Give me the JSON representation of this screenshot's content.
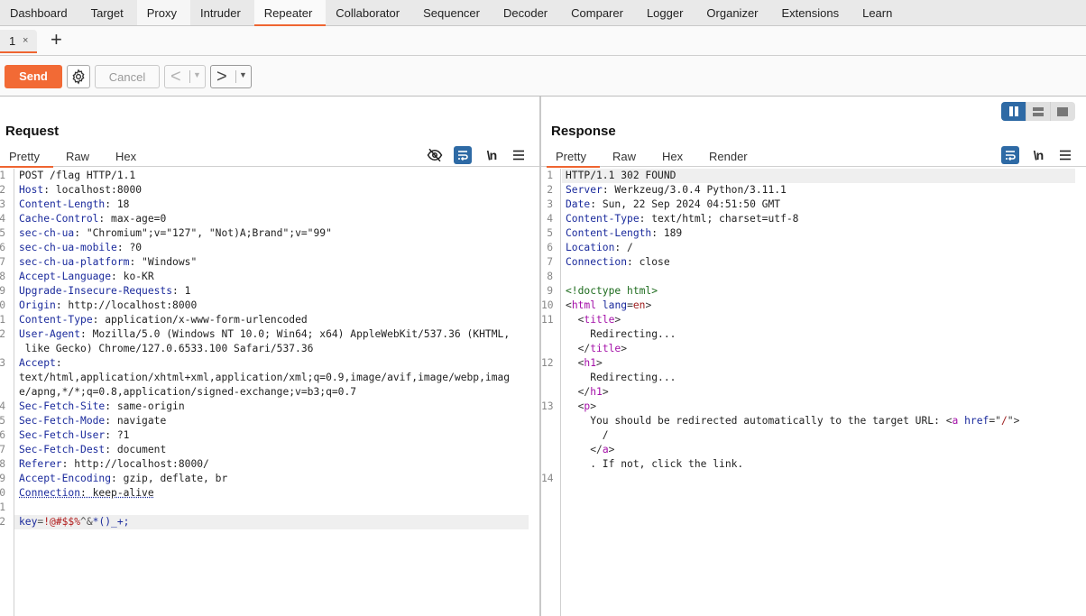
{
  "topnav": {
    "tabs": [
      {
        "label": "Dashboard"
      },
      {
        "label": "Target"
      },
      {
        "label": "Proxy"
      },
      {
        "label": "Intruder"
      },
      {
        "label": "Repeater",
        "active": true
      },
      {
        "label": "Collaborator"
      },
      {
        "label": "Sequencer"
      },
      {
        "label": "Decoder"
      },
      {
        "label": "Comparer"
      },
      {
        "label": "Logger"
      },
      {
        "label": "Organizer"
      },
      {
        "label": "Extensions"
      },
      {
        "label": "Learn"
      }
    ]
  },
  "repeater_tabs": {
    "tabs": [
      {
        "label": "1",
        "close": "×"
      }
    ],
    "add_label": "+"
  },
  "toolbar": {
    "send_label": "Send",
    "cancel_label": "Cancel",
    "back_arrow": "<",
    "forward_arrow": ">",
    "dropdown_glyph": "▼",
    "accent_color": "#f26a35"
  },
  "request": {
    "title": "Request",
    "view_tabs": [
      "Pretty",
      "Raw",
      "Hex"
    ],
    "active_view": "Pretty",
    "newline_label": "\\n",
    "lines": [
      {
        "num": "1",
        "text": "POST /flag HTTP/1.1"
      },
      {
        "num": "2",
        "name": "Host",
        "value": " localhost:8000"
      },
      {
        "num": "3",
        "name": "Content-Length",
        "value": " 18"
      },
      {
        "num": "4",
        "name": "Cache-Control",
        "value": " max-age=0"
      },
      {
        "num": "5",
        "name": "sec-ch-ua",
        "value": " \"Chromium\";v=\"127\", \"Not)A;Brand\";v=\"99\""
      },
      {
        "num": "6",
        "name": "sec-ch-ua-mobile",
        "value": " ?0"
      },
      {
        "num": "7",
        "name": "sec-ch-ua-platform",
        "value": " \"Windows\""
      },
      {
        "num": "8",
        "name": "Accept-Language",
        "value": " ko-KR"
      },
      {
        "num": "9",
        "name": "Upgrade-Insecure-Requests",
        "value": " 1"
      },
      {
        "num": "0",
        "name": "Origin",
        "value": " http://localhost:8000"
      },
      {
        "num": "1",
        "name": "Content-Type",
        "value": " application/x-www-form-urlencoded"
      },
      {
        "num": "2",
        "name": "User-Agent",
        "value": " Mozilla/5.0 (Windows NT 10.0; Win64; x64) AppleWebKit/537.36 (KHTML,"
      },
      {
        "num": "",
        "text": " like Gecko) Chrome/127.0.6533.100 Safari/537.36"
      },
      {
        "num": "3",
        "name": "Accept",
        "value": ""
      },
      {
        "num": "",
        "text": "text/html,application/xhtml+xml,application/xml;q=0.9,image/avif,image/webp,imag"
      },
      {
        "num": "",
        "text": "e/apng,*/*;q=0.8,application/signed-exchange;v=b3;q=0.7"
      },
      {
        "num": "4",
        "name": "Sec-Fetch-Site",
        "value": " same-origin"
      },
      {
        "num": "5",
        "name": "Sec-Fetch-Mode",
        "value": " navigate"
      },
      {
        "num": "6",
        "name": "Sec-Fetch-User",
        "value": " ?1"
      },
      {
        "num": "7",
        "name": "Sec-Fetch-Dest",
        "value": " document"
      },
      {
        "num": "8",
        "name": "Referer",
        "value": " http://localhost:8000/"
      },
      {
        "num": "9",
        "name": "Accept-Encoding",
        "value": " gzip, deflate, br"
      },
      {
        "num": "0",
        "name": "Connection",
        "value": " keep-alive",
        "underline": true
      },
      {
        "num": "1",
        "text": ""
      },
      {
        "num": "2",
        "body": true,
        "highlight": true,
        "key": "key",
        "eq": "=",
        "red": "!@#$$%",
        "gray": "^&",
        "blue": "*()_+;"
      }
    ]
  },
  "response": {
    "title": "Response",
    "view_tabs": [
      "Pretty",
      "Raw",
      "Hex",
      "Render"
    ],
    "active_view": "Pretty",
    "newline_label": "\\n",
    "lines": [
      {
        "num": "1",
        "text": "HTTP/1.1 302 FOUND",
        "highlight": true
      },
      {
        "num": "2",
        "name": "Server",
        "value": " Werkzeug/3.0.4 Python/3.11.1"
      },
      {
        "num": "3",
        "name": "Date",
        "value": " Sun, 22 Sep 2024 04:51:50 GMT"
      },
      {
        "num": "4",
        "name": "Content-Type",
        "value": " text/html; charset=utf-8"
      },
      {
        "num": "5",
        "name": "Content-Length",
        "value": " 189"
      },
      {
        "num": "6",
        "name": "Location",
        "value": " /"
      },
      {
        "num": "7",
        "name": "Connection",
        "value": " close"
      },
      {
        "num": "8",
        "text": ""
      },
      {
        "num": "9",
        "html": [
          {
            "cls": "doctype",
            "t": "<!doctype html>"
          }
        ]
      },
      {
        "num": "10",
        "html": [
          {
            "cls": "punct",
            "t": "<"
          },
          {
            "cls": "tag",
            "t": "html"
          },
          {
            "cls": "punct",
            "t": " "
          },
          {
            "cls": "attr",
            "t": "lang"
          },
          {
            "cls": "punct",
            "t": "="
          },
          {
            "cls": "aval",
            "t": "en"
          },
          {
            "cls": "punct",
            "t": ">"
          }
        ]
      },
      {
        "num": "11",
        "html": [
          {
            "cls": "punct",
            "t": "  <"
          },
          {
            "cls": "tag",
            "t": "title"
          },
          {
            "cls": "punct",
            "t": ">"
          }
        ]
      },
      {
        "num": "",
        "html": [
          {
            "cls": "hval",
            "t": "    Redirecting..."
          }
        ]
      },
      {
        "num": "",
        "html": [
          {
            "cls": "punct",
            "t": "  </"
          },
          {
            "cls": "tag",
            "t": "title"
          },
          {
            "cls": "punct",
            "t": ">"
          }
        ]
      },
      {
        "num": "12",
        "html": [
          {
            "cls": "punct",
            "t": "  <"
          },
          {
            "cls": "tag",
            "t": "h1"
          },
          {
            "cls": "punct",
            "t": ">"
          }
        ]
      },
      {
        "num": "",
        "html": [
          {
            "cls": "hval",
            "t": "    Redirecting..."
          }
        ]
      },
      {
        "num": "",
        "html": [
          {
            "cls": "punct",
            "t": "  </"
          },
          {
            "cls": "tag",
            "t": "h1"
          },
          {
            "cls": "punct",
            "t": ">"
          }
        ]
      },
      {
        "num": "13",
        "html": [
          {
            "cls": "punct",
            "t": "  <"
          },
          {
            "cls": "tag",
            "t": "p"
          },
          {
            "cls": "punct",
            "t": ">"
          }
        ]
      },
      {
        "num": "",
        "html": [
          {
            "cls": "hval",
            "t": "    You should be redirected automatically to the target URL: "
          },
          {
            "cls": "punct",
            "t": "<"
          },
          {
            "cls": "tag",
            "t": "a"
          },
          {
            "cls": "punct",
            "t": " "
          },
          {
            "cls": "attr",
            "t": "href"
          },
          {
            "cls": "punct",
            "t": "=\""
          },
          {
            "cls": "aval",
            "t": "/"
          },
          {
            "cls": "punct",
            "t": "\">"
          }
        ]
      },
      {
        "num": "",
        "html": [
          {
            "cls": "hval",
            "t": "      /"
          }
        ]
      },
      {
        "num": "",
        "html": [
          {
            "cls": "punct",
            "t": "    </"
          },
          {
            "cls": "tag",
            "t": "a"
          },
          {
            "cls": "punct",
            "t": ">"
          }
        ]
      },
      {
        "num": "",
        "html": [
          {
            "cls": "hval",
            "t": "    . If not, click the link."
          }
        ]
      },
      {
        "num": "14",
        "text": ""
      }
    ]
  },
  "layout_toggle": {
    "options": [
      "side-by-side",
      "top-bottom",
      "single"
    ],
    "selected": "side-by-side",
    "active_color": "#2e6aa5"
  }
}
